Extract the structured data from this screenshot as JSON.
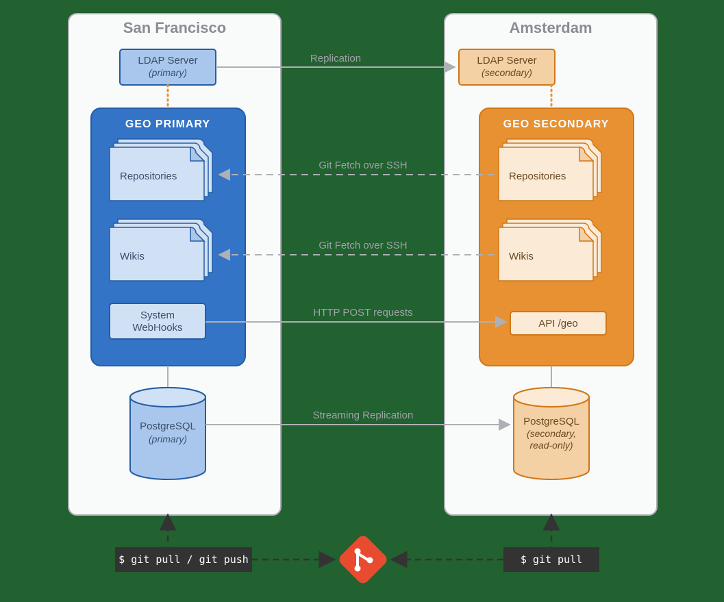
{
  "regions": {
    "left": {
      "title": "San Francisco"
    },
    "right": {
      "title": "Amsterdam"
    }
  },
  "nodes": {
    "ldap_primary": {
      "name": "LDAP Server",
      "role": "(primary)"
    },
    "ldap_secondary": {
      "name": "LDAP Server",
      "role": "(secondary)"
    },
    "geo_primary": {
      "title": "GEO PRIMARY"
    },
    "geo_secondary": {
      "title": "GEO SECONDARY"
    },
    "repos_primary": {
      "label": "Repositories"
    },
    "repos_secondary": {
      "label": "Repositories"
    },
    "wikis_primary": {
      "label": "Wikis"
    },
    "wikis_secondary": {
      "label": "Wikis"
    },
    "webhooks": {
      "line1": "System",
      "line2": "WebHooks"
    },
    "api_geo": {
      "label": "API /geo"
    },
    "pg_primary": {
      "name": "PostgreSQL",
      "role": "(primary)"
    },
    "pg_secondary": {
      "name": "PostgreSQL",
      "role1": "(secondary,",
      "role2": "read-only)"
    }
  },
  "edges": {
    "ldap_repl": "Replication",
    "repos_fetch": "Git Fetch over SSH",
    "wikis_fetch": "Git Fetch over SSH",
    "http_post": "HTTP POST requests",
    "pg_repl": "Streaming Replication"
  },
  "clients": {
    "left_cmd": "$ git pull / git push",
    "right_cmd": "$ git pull"
  },
  "colors": {
    "bg": "#226130",
    "region_fill": "#f9fafa",
    "region_stroke": "#b0b2b6",
    "region_title": "#8a8d92",
    "blue_dark": "#3374c7",
    "blue_mid": "#a9c7ec",
    "blue_light": "#d1e1f5",
    "orange_dark": "#e79133",
    "orange_mid": "#f4d0a5",
    "orange_light": "#faead6",
    "orange_stroke": "#d07717",
    "grey_line": "#adb0b4",
    "grey_text": "#686b70",
    "dark_box": "#333333",
    "git_red": "#e84b30"
  }
}
